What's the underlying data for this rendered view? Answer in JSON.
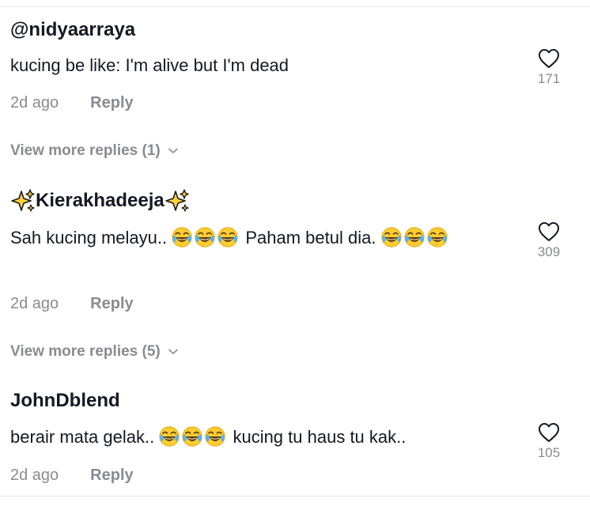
{
  "comments": [
    {
      "username": "@nidyaarraya",
      "text": "kucing be like: I'm alive but I'm dead",
      "time": "2d ago",
      "reply_label": "Reply",
      "likes": "171",
      "view_more": "View more replies (1)"
    },
    {
      "username": "Kierakhadeeja",
      "text_before": "Sah kucing melayu..",
      "text_middle": "Paham betul dia.",
      "time": "2d ago",
      "reply_label": "Reply",
      "likes": "309",
      "view_more": "View more replies (5)"
    },
    {
      "username": "JohnDblend",
      "text_before": "berair mata gelak..",
      "text_after": "kucing tu haus tu kak..",
      "time": "2d ago",
      "reply_label": "Reply",
      "likes": "105"
    }
  ],
  "colors": {
    "primary_text": "#161823",
    "secondary_text": "#8a8b91",
    "divider": "#e8e8ea"
  },
  "icons": {
    "like": "heart-outline-icon",
    "expand": "chevron-down-icon",
    "emoji": "face-with-tears-of-joy-icon",
    "username_decoration": "sparkles-icon"
  }
}
